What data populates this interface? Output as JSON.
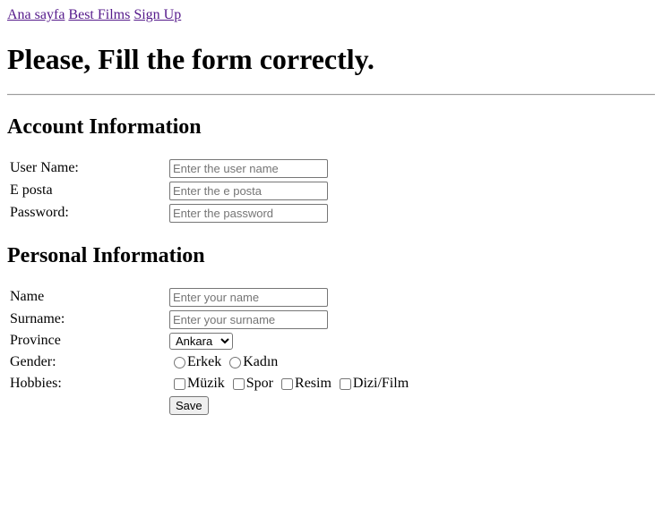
{
  "nav": {
    "links": [
      "Ana sayfa",
      "Best Films",
      "Sign Up"
    ]
  },
  "page_title": "Please, Fill the form correctly.",
  "account": {
    "heading": "Account Information",
    "username": {
      "label": "User Name:",
      "placeholder": "Enter the user name"
    },
    "email": {
      "label": "E posta",
      "placeholder": "Enter the e posta"
    },
    "password": {
      "label": "Password:",
      "placeholder": "Enter the password"
    }
  },
  "personal": {
    "heading": "Personal Information",
    "name": {
      "label": "Name",
      "placeholder": "Enter your name"
    },
    "surname": {
      "label": "Surname:",
      "placeholder": "Enter your surname"
    },
    "province": {
      "label": "Province",
      "selected": "Ankara"
    },
    "gender": {
      "label": "Gender:",
      "options": [
        "Erkek",
        "Kadın"
      ]
    },
    "hobbies": {
      "label": "Hobbies:",
      "options": [
        "Müzik",
        "Spor",
        "Resim",
        "Dizi/Film"
      ]
    },
    "save_label": "Save"
  }
}
